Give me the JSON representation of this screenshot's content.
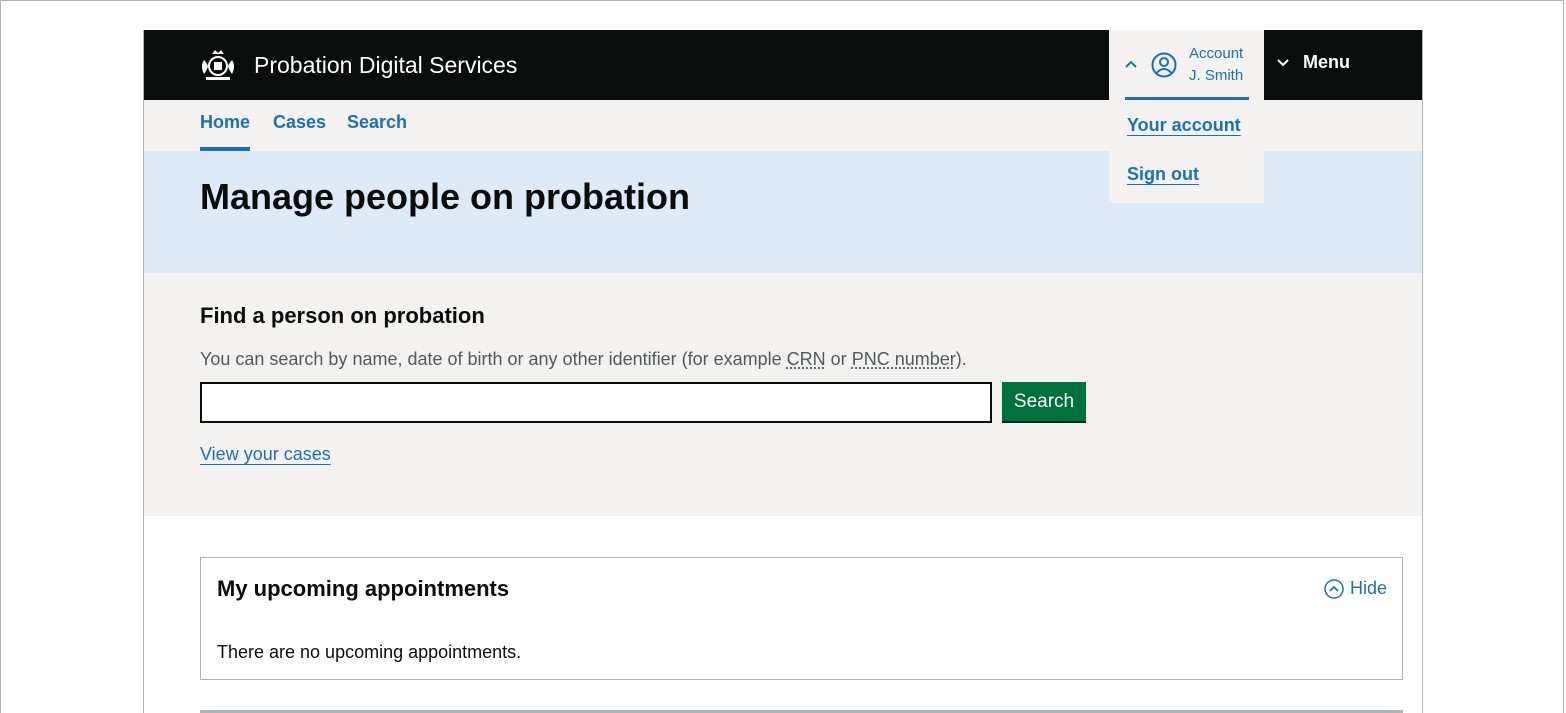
{
  "header": {
    "service_name": "Probation Digital Services",
    "account": {
      "label": "Account",
      "user_name": "J. Smith"
    },
    "menu_label": "Menu",
    "account_menu": {
      "items": [
        {
          "label": "Your account"
        },
        {
          "label": "Sign out"
        }
      ]
    }
  },
  "nav": {
    "items": [
      {
        "label": "Home",
        "active": true
      },
      {
        "label": "Cases"
      },
      {
        "label": "Search"
      }
    ]
  },
  "banner": {
    "title": "Manage people on probation"
  },
  "search": {
    "heading": "Find a person on probation",
    "hint_prefix": "You can search by name, date of birth or any other identifier (for example ",
    "hint_abbr1": "CRN",
    "hint_mid": " or ",
    "hint_abbr2": "PNC number",
    "hint_suffix": ").",
    "input_value": "",
    "button_label": "Search",
    "view_cases_link": "View your cases"
  },
  "appointments": {
    "title": "My upcoming appointments",
    "toggle_label": "Hide",
    "empty_message": "There are no upcoming appointments."
  },
  "colors": {
    "header_bg": "#0b0c0c",
    "link": "#1d70b8",
    "button_green": "#00703c",
    "banner_bg": "#ddeaf7",
    "panel_bg": "#f3f2f1"
  },
  "icons": [
    "crest-icon",
    "chevron-up-icon",
    "user-circle-icon",
    "chevron-down-icon",
    "chevron-up-circle-icon"
  ]
}
